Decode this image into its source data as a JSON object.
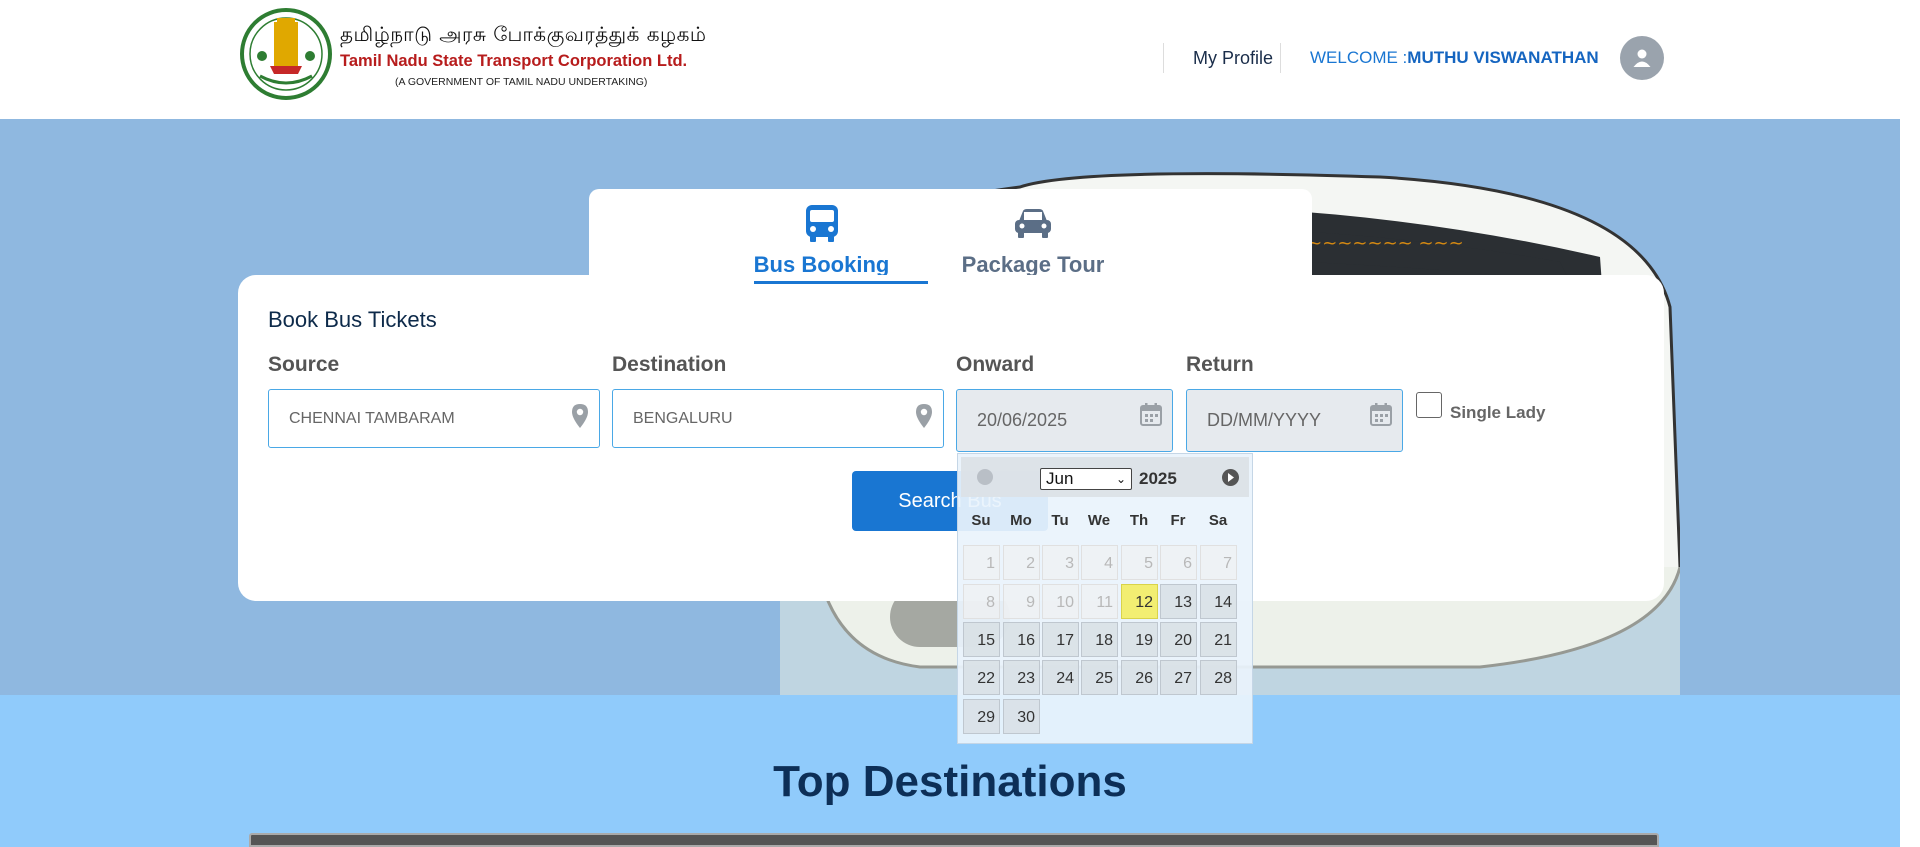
{
  "header": {
    "logo_tamil": "தமிழ்நாடு அரசு போக்குவரத்துக் கழகம்",
    "logo_english": "Tamil Nadu State Transport Corporation Ltd.",
    "logo_subtitle": "(A GOVERNMENT OF TAMIL NADU UNDERTAKING)",
    "my_profile": "My Profile",
    "welcome_prefix": "WELCOME :",
    "user_name": "MUTHU VISWANATHAN"
  },
  "tabs": {
    "bus_booking": "Bus Booking",
    "package_tour": "Package Tour",
    "active": "Bus Booking"
  },
  "booking": {
    "title": "Book Bus Tickets",
    "source_label": "Source",
    "source_value": "CHENNAI TAMBARAM",
    "destination_label": "Destination",
    "destination_value": "BENGALURU",
    "onward_label": "Onward",
    "onward_value": "20/06/2025",
    "return_label": "Return",
    "return_placeholder": "DD/MM/YYYY",
    "single_lady_label": "Single Lady",
    "search_button": "Search Bus"
  },
  "datepicker": {
    "month": "Jun",
    "year": "2025",
    "weekdays": [
      "Su",
      "Mo",
      "Tu",
      "We",
      "Th",
      "Fr",
      "Sa"
    ],
    "today": "12",
    "disabled_days": [
      "1",
      "2",
      "3",
      "4",
      "5",
      "6",
      "7",
      "8",
      "9",
      "10",
      "11"
    ],
    "days": [
      "1",
      "2",
      "3",
      "4",
      "5",
      "6",
      "7",
      "8",
      "9",
      "10",
      "11",
      "12",
      "13",
      "14",
      "15",
      "16",
      "17",
      "18",
      "19",
      "20",
      "21",
      "22",
      "23",
      "24",
      "25",
      "26",
      "27",
      "28",
      "29",
      "30"
    ]
  },
  "bottom": {
    "heading": "Top Destinations"
  },
  "colors": {
    "primary": "#1976d2",
    "hero_bg": "#8fb8e0",
    "bottom_bg": "#90cbfb",
    "today_highlight": "#f2ee72",
    "logo_red": "#b71c1c"
  }
}
